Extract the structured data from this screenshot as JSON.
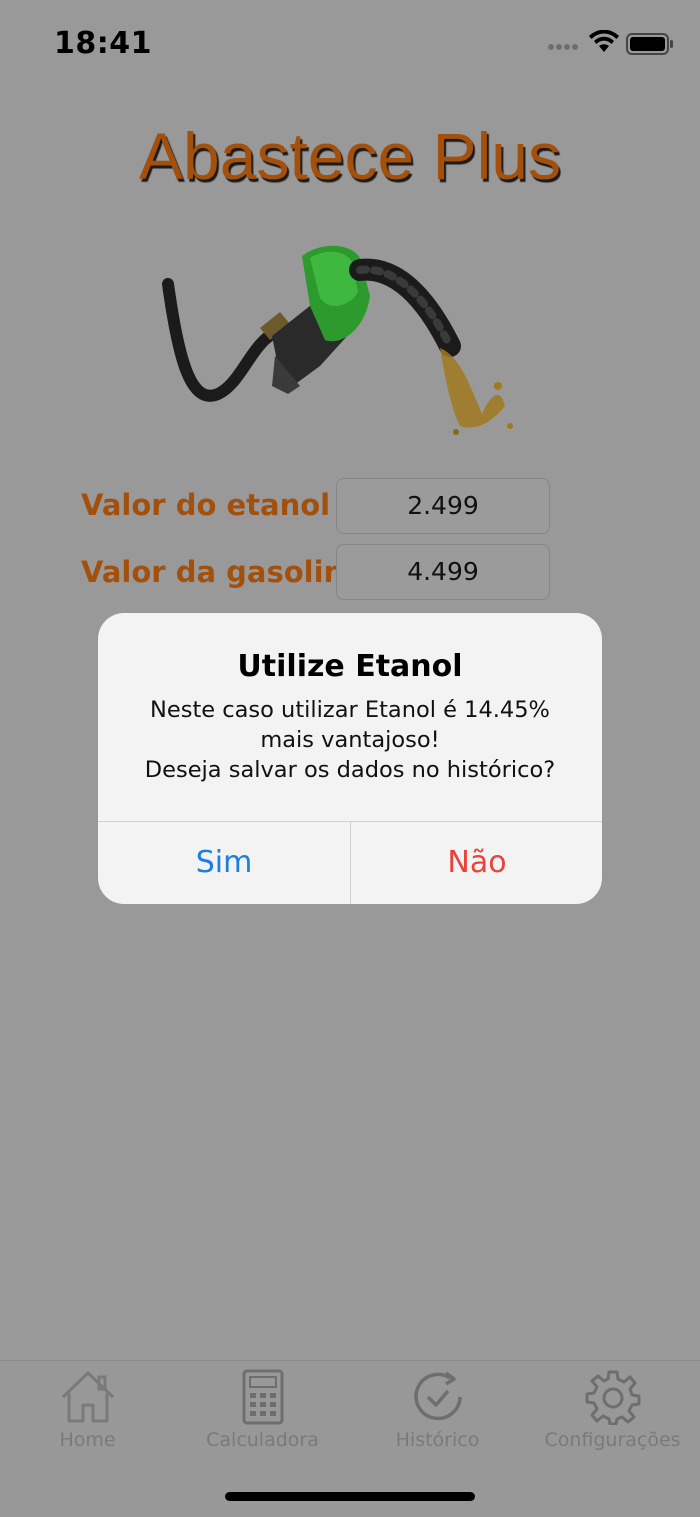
{
  "status": {
    "time": "18:41"
  },
  "app": {
    "title": "Abastece Plus"
  },
  "form": {
    "ethanol_label": "Valor do etanol",
    "ethanol_value": "2.499",
    "gasoline_label": "Valor da gasolina",
    "gasoline_value": "4.499"
  },
  "alert": {
    "title": "Utilize Etanol",
    "message_lines": [
      "Neste caso utilizar Etanol é 14.45%",
      "mais vantajoso!",
      "Deseja salvar os dados no histórico?"
    ],
    "yes_label": "Sim",
    "no_label": "Não"
  },
  "tabs": [
    {
      "label": "Home",
      "icon": "home-icon"
    },
    {
      "label": "Calculadora",
      "icon": "calculator-icon"
    },
    {
      "label": "Histórico",
      "icon": "history-icon"
    },
    {
      "label": "Configurações",
      "icon": "gear-icon"
    }
  ],
  "colors": {
    "accent": "#a4500d",
    "yes": "#1a7fe3",
    "no": "#e8443a",
    "overlay": "#999999"
  }
}
